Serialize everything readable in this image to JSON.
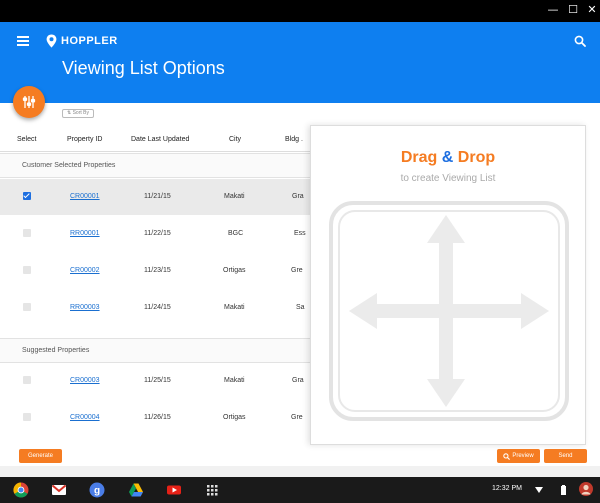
{
  "app": {
    "name": "HOPPLER",
    "title": "Viewing List Options"
  },
  "window_controls": [
    {
      "name": "minimize",
      "glyph": "—"
    },
    {
      "name": "maximize",
      "glyph": "☐"
    },
    {
      "name": "close",
      "glyph": "✕"
    }
  ],
  "sort_by": "Sort By",
  "table": {
    "headers": [
      "Select",
      "Property ID",
      "Date Last Updated",
      "City",
      "Bldg ."
    ],
    "sections": [
      {
        "label": "Customer Selected Properties",
        "rows": [
          {
            "checked": true,
            "property_id": "CR00001",
            "date": "11/21/15",
            "city": "Makati",
            "bldg": "Gra"
          },
          {
            "checked": false,
            "property_id": "RR00001",
            "date": "11/22/15",
            "city": "BGC",
            "bldg": "Ess"
          },
          {
            "checked": false,
            "property_id": "CR00002",
            "date": "11/23/15",
            "city": "Ortigas",
            "bldg": "Gre"
          },
          {
            "checked": false,
            "property_id": "RR00003",
            "date": "11/24/15",
            "city": "Makati",
            "bldg": "Sa"
          }
        ]
      },
      {
        "label": "Suggested Properties",
        "rows": [
          {
            "checked": false,
            "property_id": "CR00003",
            "date": "11/25/15",
            "city": "Makati",
            "bldg": "Gra"
          },
          {
            "checked": false,
            "property_id": "CR00004",
            "date": "11/26/15",
            "city": "Ortigas",
            "bldg": "Gre"
          }
        ]
      }
    ]
  },
  "drop_zone": {
    "title_drag": "Drag",
    "title_amp": "&",
    "title_drop": "Drop",
    "subtitle": "to create Viewing List"
  },
  "buttons": {
    "generate": "Generate",
    "preview": "Preview",
    "send": "Send"
  },
  "taskbar": {
    "apps": [
      "chrome-icon",
      "gmail-icon",
      "google-plus-icon",
      "drive-icon",
      "youtube-icon",
      "app-launcher-icon"
    ],
    "time": "12:32 PM"
  },
  "colors": {
    "primary": "#0e7ff0",
    "accent": "#f57c22",
    "link": "#1a6fd0"
  }
}
